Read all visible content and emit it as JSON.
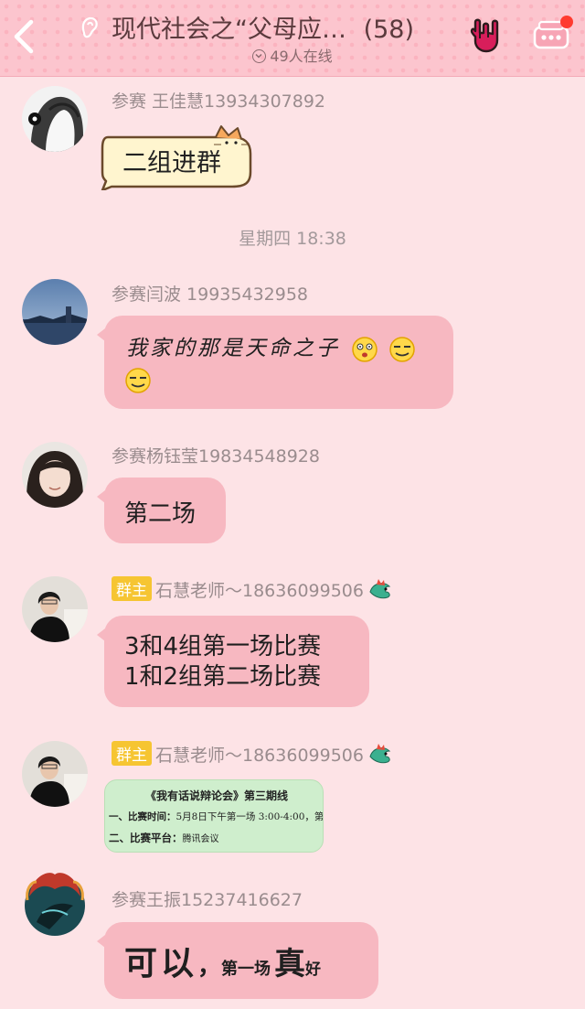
{
  "header": {
    "title": "现代社会之“父母应…",
    "count": "(58)",
    "online": "49人在线",
    "colors": {
      "header_bg": "#fcc5ce",
      "dot": "#fbb3bf",
      "text": "#5b3a3d"
    }
  },
  "time_separator": "星期四 18:38",
  "messages": [
    {
      "sender": "参赛 王佳慧13934307892",
      "text": "二组进群"
    },
    {
      "sender": "参赛闫波 19935432958",
      "text": "我家的那是天命之子"
    },
    {
      "sender": "参赛杨钰莹19834548928",
      "text": "第二场"
    },
    {
      "badge": "群主",
      "sender": "石慧老师～18636099506",
      "lines": [
        "3和4组第一场比赛",
        "1和2组第二场比赛"
      ]
    },
    {
      "badge": "群主",
      "sender": "石慧老师～18636099506",
      "doc": {
        "title": "《我有话说辩论会》第三期线",
        "line1_label": "一、比赛时间：",
        "line1_value": "5月8日下午第一场 3:00-4:00，第",
        "line2_label": "二、比赛平台：",
        "line2_value": "腾讯会议"
      }
    },
    {
      "sender": "参赛王振15237416627",
      "text_big": "可以",
      "text_comma": "，",
      "text_small": "第一场",
      "text_big2": "真",
      "text_small2": "好"
    }
  ],
  "bubble_color": "#f7b8c1",
  "badge_color": "#f6c532"
}
